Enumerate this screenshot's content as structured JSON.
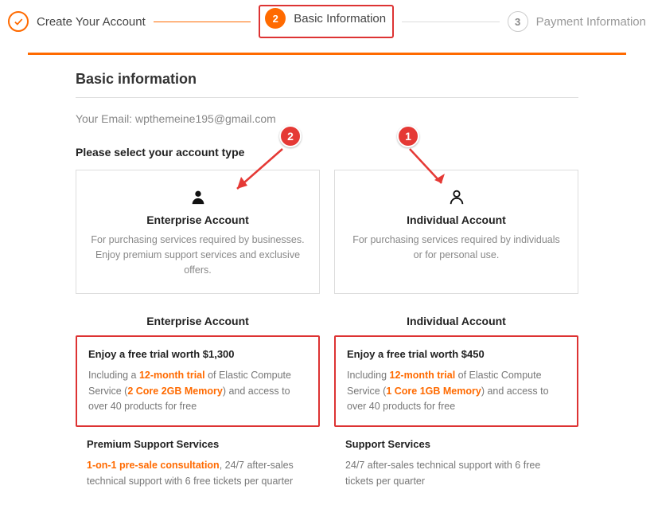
{
  "wizard": {
    "step1": {
      "label": "Create Your Account"
    },
    "step2": {
      "num": "2",
      "label": "Basic Information"
    },
    "step3": {
      "num": "3",
      "label": "Payment Information"
    }
  },
  "section": {
    "title": "Basic information"
  },
  "email": {
    "label": "Your Email:",
    "value": "wpthemeine195@gmail.com"
  },
  "subhead": "Please select your account type",
  "cards": {
    "enterprise": {
      "title": "Enterprise Account",
      "desc": "For purchasing services required by businesses. Enjoy premium support services and exclusive offers."
    },
    "individual": {
      "title": "Individual Account",
      "desc": "For purchasing services required by individuals or for personal use."
    }
  },
  "compare": {
    "enterprise": {
      "head": "Enterprise Account",
      "trial_title": "Enjoy a free trial worth $1,300",
      "trial_pre": "Including a ",
      "trial_h1": "12-month trial",
      "trial_mid": " of Elastic Compute Service (",
      "trial_h2": "2 Core 2GB Memory",
      "trial_post": ") and access to over 40 products for free",
      "sup_title": "Premium Support Services",
      "sup_h": "1-on-1 pre-sale consultation",
      "sup_rest": ", 24/7 after-sales technical support with 6 free tickets per quarter"
    },
    "individual": {
      "head": "Individual Account",
      "trial_title": "Enjoy a free trial worth $450",
      "trial_pre": "Including ",
      "trial_h1": "12-month trial",
      "trial_mid": " of Elastic Compute Service (",
      "trial_h2": "1 Core 1GB Memory",
      "trial_post": ") and access to over 40 products for free",
      "sup_title": "Support Services",
      "sup_desc": "24/7 after-sales technical support with 6 free tickets per quarter"
    }
  },
  "ann": {
    "one": "1",
    "two": "2"
  }
}
